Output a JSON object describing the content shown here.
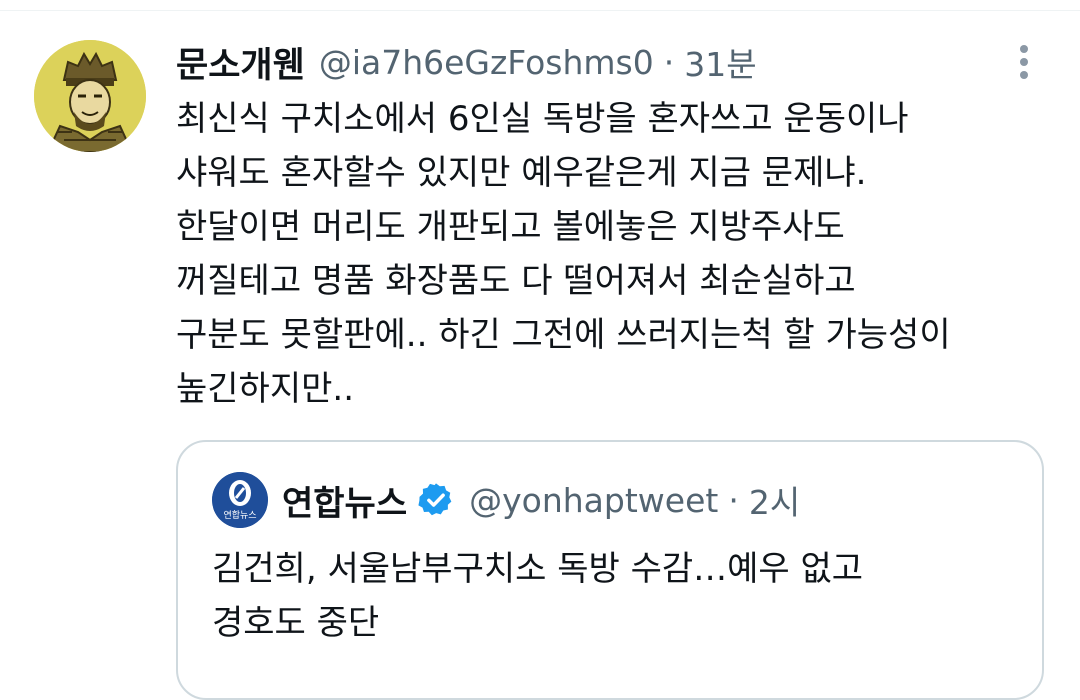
{
  "tweet": {
    "display_name": "문소개웬",
    "handle": "@ia7h6eGzFoshms0",
    "separator": "·",
    "time": "31분",
    "lines": [
      "최신식 구치소에서 6인실 독방을 혼자쓰고 운동이나",
      "샤워도 혼자할수 있지만 예우같은게 지금 문제냐.",
      "한달이면 머리도 개판되고 볼에놓은 지방주사도",
      "꺼질테고 명품 화장품도 다 떨어져서 최순실하고",
      "구분도 못할판에.. 하긴 그전에 쓰러지는척 할 가능성이",
      "높긴하지만.."
    ]
  },
  "quoted": {
    "display_name": "연합뉴스",
    "logo_text": "연합뉴스",
    "handle": "@yonhaptweet",
    "separator": "·",
    "time": "2시",
    "lines": [
      "김건희, 서울남부구치소 독방 수감…예우 없고",
      "경호도 중단"
    ],
    "verified_color": "#1d9bf0",
    "logo_color": "#1f4e9a"
  },
  "icons": {
    "avatar": "portrait-avatar",
    "more": "more-vertical-icon",
    "verified": "verified-badge-icon"
  }
}
